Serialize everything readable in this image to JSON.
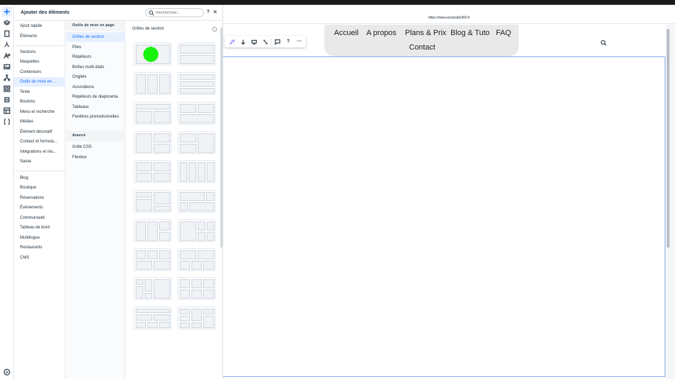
{
  "panel": {
    "title": "Ajouter des éléments",
    "search_placeholder": "Rechercher...",
    "help_label": "?",
    "close_label": "✕"
  },
  "categories": {
    "group1": [
      "Ajout rapide",
      "Éléments"
    ],
    "group2": [
      "Sections",
      "Maquettes",
      "Conteneurs",
      "Outils de mise en ...",
      "Texte",
      "Boutons",
      "Menu et recherche",
      "Médias",
      "Élément décoratif",
      "Contact et formula...",
      "Intégrations et rés...",
      "Saisie"
    ],
    "group3": [
      "Blog",
      "Boutique",
      "Réservations",
      "Événements",
      "Communauté",
      "Tableau de bord",
      "Multilingue",
      "Restaurants",
      "CMS"
    ],
    "active": "Outils de mise en ..."
  },
  "subcategories": {
    "heading": "Outils de mise en page",
    "items": [
      "Grilles de section",
      "Piles",
      "Répéteurs",
      "Boîtes multi-états",
      "Onglets",
      "Accordéons",
      "Répéteurs de diaporama",
      "Tableaux",
      "Fenêtres promotionnelles"
    ],
    "advanced_heading": "Avancé",
    "advanced_items": [
      "Grille CSS",
      "Flexbox"
    ],
    "active": "Grilles de section"
  },
  "preview": {
    "title": "Grilles de section",
    "info_label": "i"
  },
  "browser": {
    "url": "https://www.wixstudio360.fr"
  },
  "site_nav": {
    "items": [
      "Accueil",
      "A propos",
      "Plans & Prix",
      "Blog & Tuto",
      "FAQ",
      "Contact"
    ]
  },
  "toolbar": {
    "help_label": "?",
    "more_label": "···"
  },
  "colors": {
    "accent": "#116dff",
    "highlight_dot": "#18f20e",
    "nav_pill": "#e9e9e9"
  }
}
